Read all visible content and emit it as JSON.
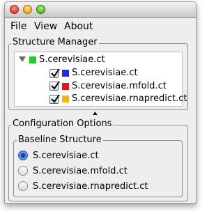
{
  "menubar": {
    "items": [
      "File",
      "View",
      "About"
    ]
  },
  "structure_manager": {
    "title": "Structure Manager",
    "root": {
      "label": "S.cerevisiae.ct",
      "expanded": true,
      "color": "#22cc22"
    },
    "children": [
      {
        "label": "S.cerevisiae.ct",
        "checked": true,
        "color": "#1f2fe0"
      },
      {
        "label": "S.cerevisiae.mfold.ct",
        "checked": true,
        "color": "#e01818"
      },
      {
        "label": "S.cerevisiae.rnapredict.ct",
        "checked": true,
        "color": "#f2b21a"
      }
    ]
  },
  "configuration": {
    "title": "Configuration Options",
    "baseline": {
      "title": "Baseline Structure",
      "options": [
        {
          "label": "S.cerevisiae.ct",
          "selected": true
        },
        {
          "label": "S.cerevisiae.mfold.ct",
          "selected": false
        },
        {
          "label": "S.cerevisiae.rnapredict.ct",
          "selected": false
        }
      ]
    }
  }
}
